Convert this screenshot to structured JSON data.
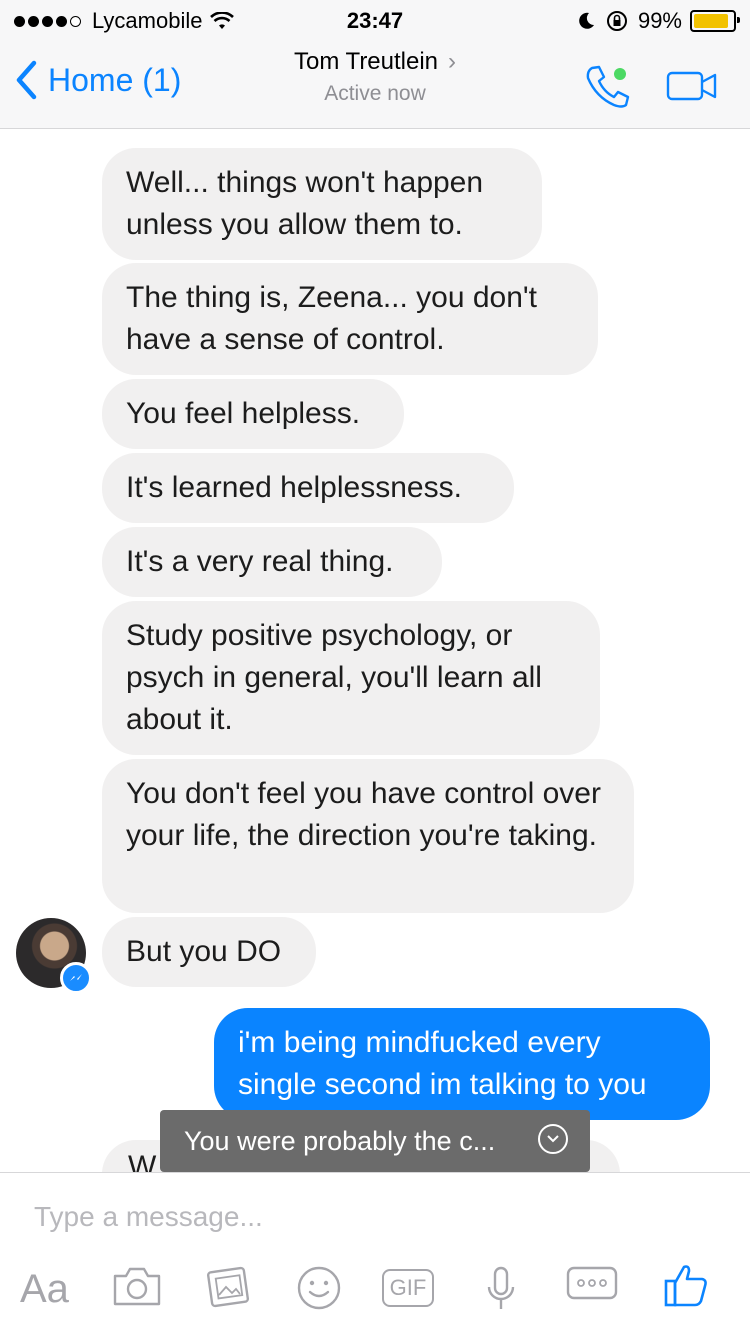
{
  "status_bar": {
    "carrier": "Lycamobile",
    "time": "23:47",
    "battery": "99%",
    "battery_level": 0.99
  },
  "nav": {
    "back_label": "Home (1)",
    "contact_name": "Tom Treutlein",
    "presence": "Active now",
    "accent_color": "#0b84ff",
    "presence_color": "#4cd964"
  },
  "messages": [
    {
      "side": "in",
      "text": "Well... things won't happen unless you allow them to."
    },
    {
      "side": "in",
      "text": "The thing is, Zeena... you don't have a sense of control."
    },
    {
      "side": "in",
      "text": "You feel helpless."
    },
    {
      "side": "in",
      "text": "It's learned helplessness."
    },
    {
      "side": "in",
      "text": "It's a very real thing."
    },
    {
      "side": "in",
      "text": "Study positive psychology, or psych in general, you'll learn all about it."
    },
    {
      "side": "in",
      "text": "You don't feel you have control over your life, the direction you're taking."
    },
    {
      "side": "in",
      "text": "But you DO"
    },
    {
      "side": "out",
      "text": "i'm being mindfucked every single second im talking to you"
    }
  ],
  "toast": {
    "text": "You were probably the c..."
  },
  "peek_text": "W",
  "composer": {
    "placeholder": "Type a message...",
    "aa_label": "Aa",
    "gif_label": "GIF",
    "icons": [
      "camera-icon",
      "gallery-icon",
      "emoji-icon",
      "gif-icon",
      "microphone-icon",
      "more-icon",
      "like-icon"
    ]
  }
}
